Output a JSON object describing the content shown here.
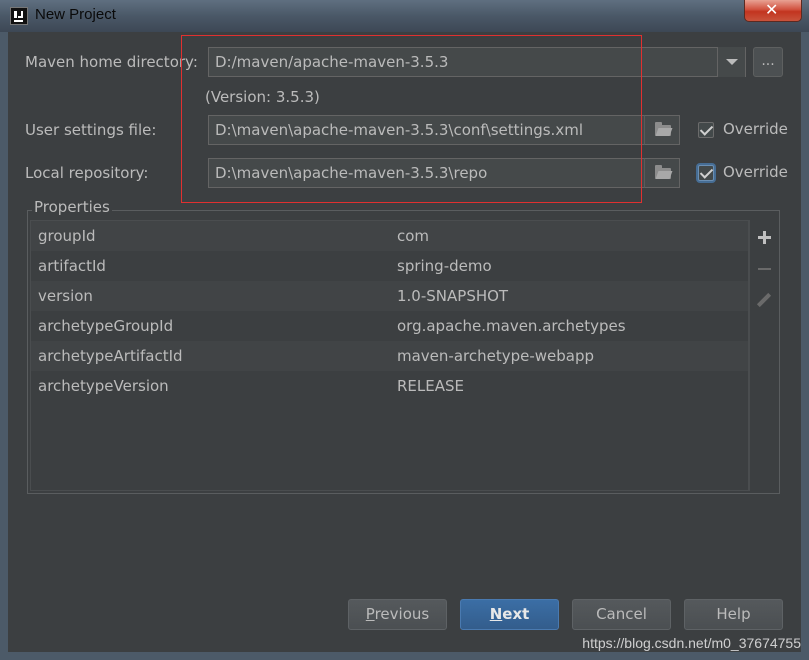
{
  "window": {
    "title": "New Project",
    "close_symbol": "✕"
  },
  "maven_home": {
    "label": "Maven home directory:",
    "value": "D:/maven/apache-maven-3.5.3",
    "version": "(Version: 3.5.3)",
    "browse_label": "..."
  },
  "user_settings": {
    "label": "User settings file:",
    "value": "D:\\maven\\apache-maven-3.5.3\\conf\\settings.xml",
    "override_label": "Override",
    "override_checked": true
  },
  "local_repo": {
    "label": "Local repository:",
    "value": "D:\\maven\\apache-maven-3.5.3\\repo",
    "override_label": "Override",
    "override_checked": true
  },
  "properties": {
    "title": "Properties",
    "rows": [
      {
        "key": "groupId",
        "value": "com"
      },
      {
        "key": "artifactId",
        "value": "spring-demo"
      },
      {
        "key": "version",
        "value": "1.0-SNAPSHOT"
      },
      {
        "key": "archetypeGroupId",
        "value": "org.apache.maven.archetypes"
      },
      {
        "key": "archetypeArtifactId",
        "value": "maven-archetype-webapp"
      },
      {
        "key": "archetypeVersion",
        "value": "RELEASE"
      }
    ]
  },
  "buttons": {
    "previous_mnemonic": "P",
    "previous_rest": "revious",
    "next_mnemonic": "N",
    "next_rest": "ext",
    "cancel": "Cancel",
    "help": "Help"
  },
  "watermark": "https://blog.csdn.net/m0_37674755"
}
